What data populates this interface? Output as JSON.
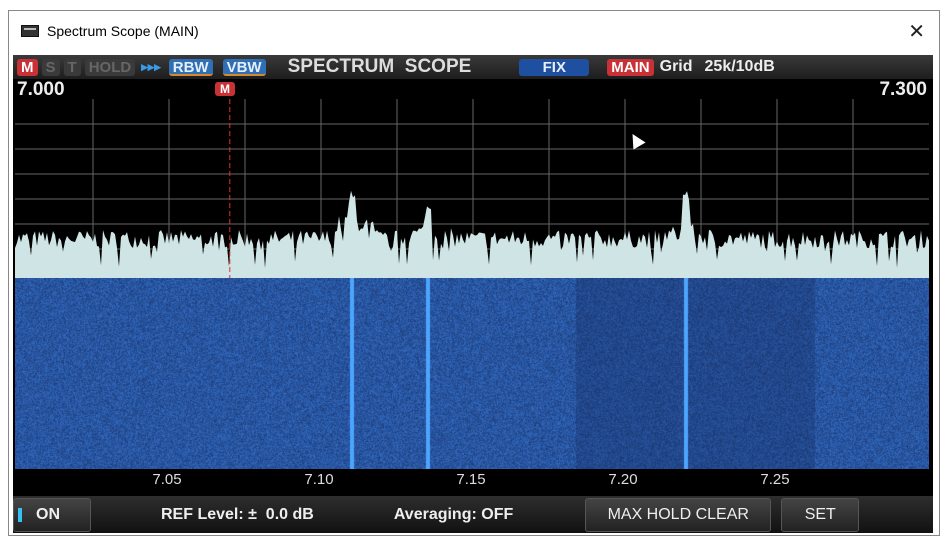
{
  "window": {
    "title": "Spectrum Scope (MAIN)",
    "close": "✕"
  },
  "header": {
    "m": "M",
    "s": "S",
    "t": "T",
    "hold": "HOLD",
    "arrows": "▸▸▸",
    "rbw": "RBW",
    "vbw": "VBW",
    "title": "SPECTRUM  SCOPE",
    "fix": "FIX",
    "main": "MAIN",
    "grid": "Grid",
    "scale": "25k/10dB"
  },
  "freq": {
    "start": "7.000",
    "end": "7.300",
    "marker": "M",
    "marker_mhz": 7.07
  },
  "axis": {
    "ticks": [
      "7.05",
      "7.10",
      "7.15",
      "7.20",
      "7.25"
    ]
  },
  "signals_mhz": [
    7.11,
    7.135,
    7.22
  ],
  "bottom": {
    "on": "ON",
    "ref": "REF Level: ±  0.0 dB",
    "avg": "Averaging: OFF",
    "maxhold": "MAX HOLD CLEAR",
    "set": "SET"
  },
  "colors": {
    "accent_red": "#c83236",
    "accent_blue": "#2f6fb5",
    "spectrum_fill": "#cfe4e4"
  }
}
